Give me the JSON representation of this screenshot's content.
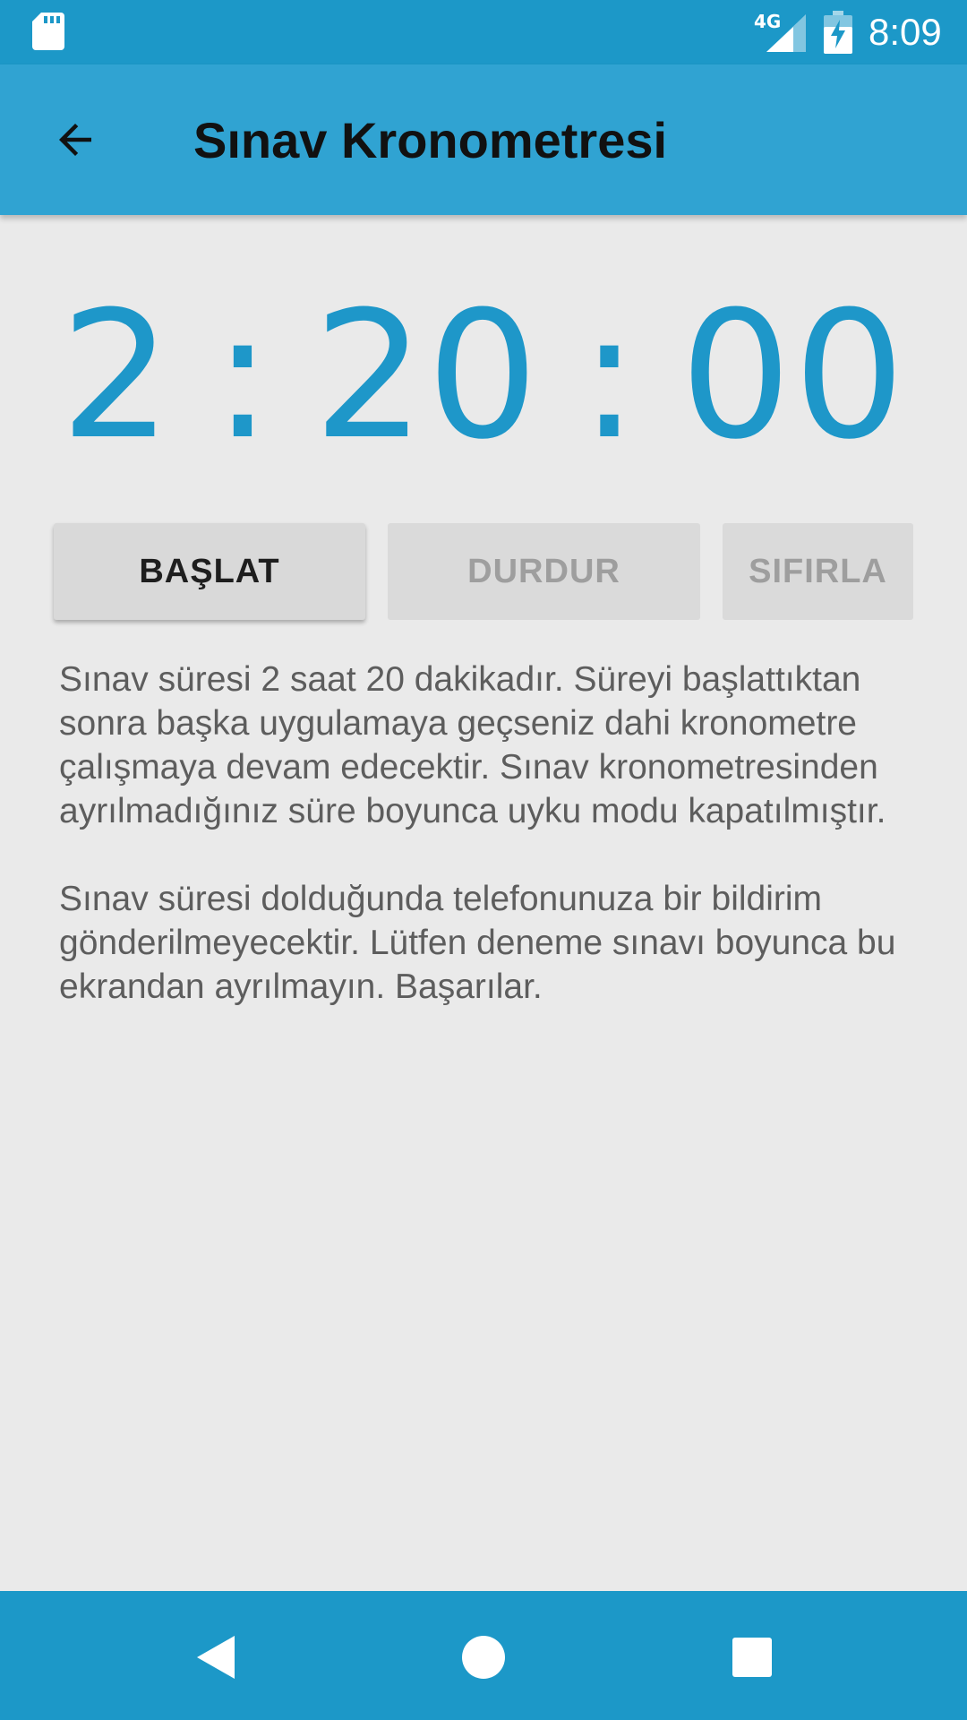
{
  "status_bar": {
    "network_type": "4G",
    "time": "8:09",
    "icons": [
      "sd-card-icon",
      "signal-icon",
      "battery-charging-icon"
    ]
  },
  "app_bar": {
    "title": "Sınav Kronometresi",
    "back_icon": "arrow-back-icon"
  },
  "timer": {
    "hours": "2",
    "minutes": "20",
    "seconds": "00",
    "separator": ":"
  },
  "buttons": {
    "start": "BAŞLAT",
    "stop": "DURDUR",
    "reset": "SIFIRLA"
  },
  "description": {
    "paragraph1": "Sınav süresi 2 saat 20 dakikadır. Süreyi başlattıktan sonra başka uygulamaya geçseniz dahi kronometre çalışmaya devam edecektir. Sınav kronometresinden ayrılmadığınız süre boyunca uyku modu kapatılmıştır.",
    "paragraph2": "Sınav süresi dolduğunda telefonunuza bir bildirim gönderilmeyecektir. Lütfen deneme sınavı boyunca bu ekrandan ayrılmayın. Başarılar."
  },
  "nav_bar": {
    "icons": [
      "nav-back-icon",
      "nav-home-icon",
      "nav-recents-icon"
    ]
  },
  "colors": {
    "status_bar": "#1c98c8",
    "app_bar": "#30a3d2",
    "timer_accent": "#1e97c9",
    "background": "#eaeaea"
  }
}
